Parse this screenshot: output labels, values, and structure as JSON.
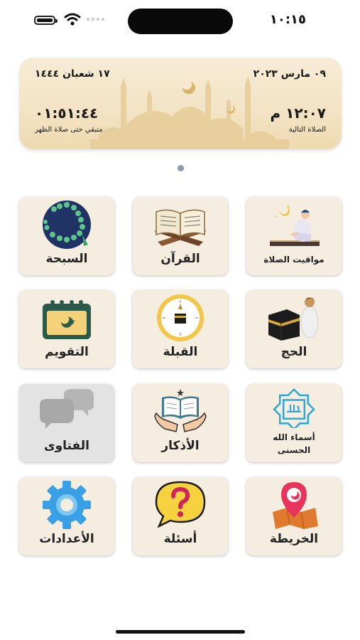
{
  "status_bar": {
    "time": "١٠:١٥"
  },
  "prayer_card": {
    "gregorian_date": "٠٩ مارس ٢٠٢٣",
    "hijri_date": "١٧ شعبان ١٤٤٤",
    "next_prayer_time": "١٢:٠٧ م",
    "next_prayer_label": "الصلاة التالية",
    "countdown": "٠١:٥١:٤٤",
    "countdown_label": "متبقي حتى صلاة الظهر"
  },
  "pager": {
    "pages": 1,
    "current": 1
  },
  "grid": {
    "prayer_times": "مواقيت الصلاة",
    "quran": "القرآن",
    "tasbeeh": "السبحة",
    "hajj": "الحج",
    "qibla": "القبلة",
    "calendar": "التقويم",
    "names_line1": "أسماء الله",
    "names_line2": "الحسنى",
    "adhkar": "الأذكار",
    "fatawa": "الفتاوى",
    "map": "الخريطة",
    "questions": "أسئلة",
    "settings": "الأعدادات"
  },
  "icons": {
    "tile_background": "#f6ede1",
    "disabled_tile_background": "#e3e3e3",
    "card_gold": "#e9d2a1"
  }
}
